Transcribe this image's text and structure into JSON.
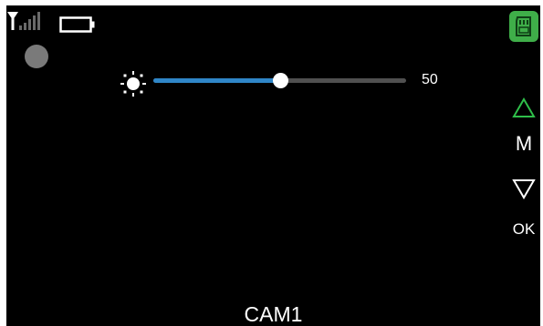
{
  "status_bar": {
    "antenna_icon": "antenna-icon",
    "signal_icon": "signal-strength-icon",
    "battery_icon": "battery-icon"
  },
  "record_indicator": {
    "icon": "record-dot-icon",
    "color": "#7a7a7a"
  },
  "storage": {
    "icon": "sd-card-icon",
    "color": "#3fae49"
  },
  "brightness": {
    "icon": "sun-brightness-icon",
    "value": "50",
    "level": 0.5,
    "fill_color": "#2f86c8"
  },
  "side_menu": {
    "up_icon": "triangle-up-icon",
    "mode_label": "M",
    "down_icon": "triangle-down-icon",
    "ok_label": "OK",
    "accent_color": "#2fbf4a"
  },
  "camera": {
    "label": "CAM1"
  }
}
